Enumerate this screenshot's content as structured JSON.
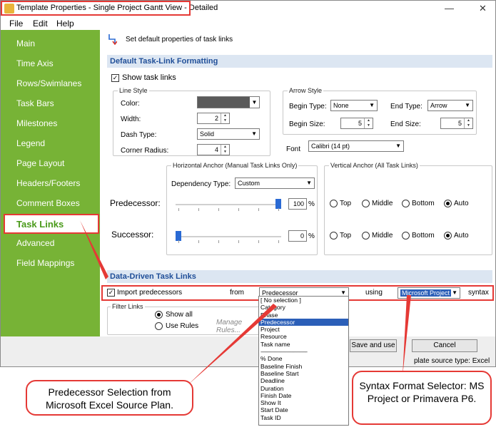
{
  "window": {
    "title": "Template Properties - Single Project Gantt View - Detailed",
    "minimize": "—",
    "close": "✕"
  },
  "menu": [
    "File",
    "Edit",
    "Help"
  ],
  "sidebar": {
    "items": [
      "Main",
      "Time Axis",
      "Rows/Swimlanes",
      "Task Bars",
      "Milestones",
      "Legend",
      "Page Layout",
      "Headers/Footers",
      "Comment Boxes",
      "Task Links",
      "Advanced",
      "Field Mappings"
    ],
    "active": "Task Links"
  },
  "page": {
    "description": "Set default properties of task links",
    "section1_title": "Default Task-Link Formatting",
    "show_task_links": "Show task links",
    "line_style": {
      "group": "Line Style",
      "color_label": "Color:",
      "width_label": "Width:",
      "width_value": "2",
      "dash_label": "Dash Type:",
      "dash_value": "Solid",
      "radius_label": "Corner Radius:",
      "radius_value": "4"
    },
    "arrow_style": {
      "group": "Arrow Style",
      "begin_type_label": "Begin Type:",
      "begin_type_value": "None",
      "end_type_label": "End Type:",
      "end_type_value": "Arrow",
      "begin_size_label": "Begin Size:",
      "begin_size_value": "5",
      "end_size_label": "End Size:",
      "end_size_value": "5"
    },
    "font_label": "Font",
    "font_value": "Calibri (14 pt)",
    "horizontal_anchor": {
      "group": "Horizontal Anchor (Manual Task Links Only)",
      "dep_type_label": "Dependency Type:",
      "dep_type_value": "Custom",
      "predecessor_label": "Predecessor:",
      "predecessor_value": "100",
      "successor_label": "Successor:",
      "successor_value": "0",
      "percent": "%"
    },
    "vertical_anchor": {
      "group": "Vertical Anchor (All Task Links)",
      "options": [
        "Top",
        "Middle",
        "Bottom",
        "Auto"
      ]
    },
    "section2_title": "Data-Driven Task Links",
    "import_predecessors": "Import predecessors",
    "from_label": "from",
    "from_value": "Predecessor",
    "using_label": "using",
    "using_value": "Microsoft Project",
    "syntax_label": "syntax",
    "filter_group": "Filter Links",
    "show_all": "Show all",
    "use_rules": "Use Rules",
    "manage_rules": "Manage Rules..."
  },
  "footer": {
    "save_and_use": "Save and use",
    "cancel": "Cancel",
    "source_type": "plate source type: Excel"
  },
  "dropdown_list": {
    "items": [
      "[ No selection ]",
      "Category",
      "Phase",
      "Predecessor",
      "Project",
      "Resource",
      "Task name",
      "-----------------------------------",
      "% Done",
      "Baseline Finish",
      "Baseline Start",
      "Deadline",
      "Duration",
      "Finish Date",
      "Show It",
      "Start Date",
      "Task ID"
    ],
    "selected": "Predecessor"
  },
  "callouts": {
    "left": "Predecessor Selection from Microsoft Excel Source Plan.",
    "right": "Syntax Format Selector: MS Project or Primavera P6."
  },
  "colors": {
    "sidebar": "#77b336",
    "annotation": "#e53935",
    "section_header_bg": "#dce6f2",
    "section_header_text": "#1f4e98",
    "selection": "#2b5fb8"
  }
}
